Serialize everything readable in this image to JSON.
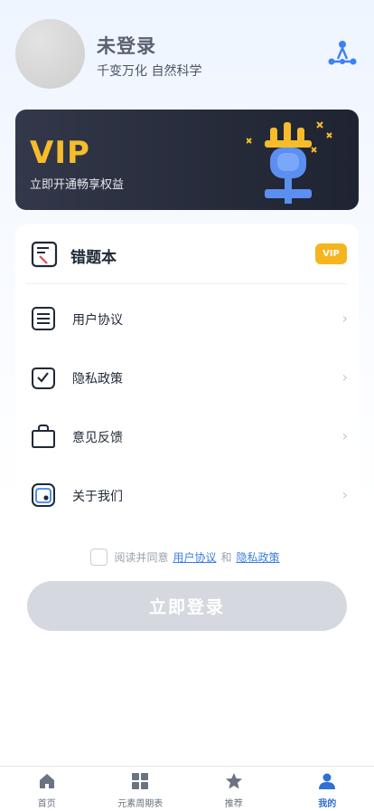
{
  "header": {
    "user_name": "未登录",
    "user_subtitle": "千变万化 自然科学",
    "share_icon": "share-icon"
  },
  "vip_banner": {
    "title": "VIP",
    "subtitle": "立即开通畅享权益",
    "art_icon": "microphone-trophy-icon"
  },
  "menu": {
    "wrong_book": {
      "label": "错题本",
      "badge": "VIP",
      "icon": "note-icon"
    },
    "items": [
      {
        "label": "用户协议",
        "icon": "document-lines-icon",
        "chevron": "›"
      },
      {
        "label": "隐私政策",
        "icon": "check-shield-icon",
        "chevron": "›"
      },
      {
        "label": "意见反馈",
        "icon": "bag-icon",
        "chevron": "›"
      },
      {
        "label": "关于我们",
        "icon": "info-box-icon",
        "chevron": "›"
      }
    ]
  },
  "agreement": {
    "prefix": "阅读并同意",
    "user_agreement_link": "用户协议",
    "and": "和",
    "privacy_link": "隐私政策"
  },
  "login_button": {
    "label": "立即登录"
  },
  "tabbar": {
    "tabs": [
      {
        "label": "首页",
        "icon": "home-icon"
      },
      {
        "label": "元素周期表",
        "icon": "grid-icon"
      },
      {
        "label": "推荐",
        "icon": "star-icon"
      },
      {
        "label": "我的",
        "icon": "user-icon",
        "active": true
      }
    ]
  },
  "colors": {
    "accent": "#2f6fd6",
    "vip_gold": "#f6bc2a",
    "banner_dark": "#262b3a",
    "login_disabled": "#d5d8df"
  }
}
